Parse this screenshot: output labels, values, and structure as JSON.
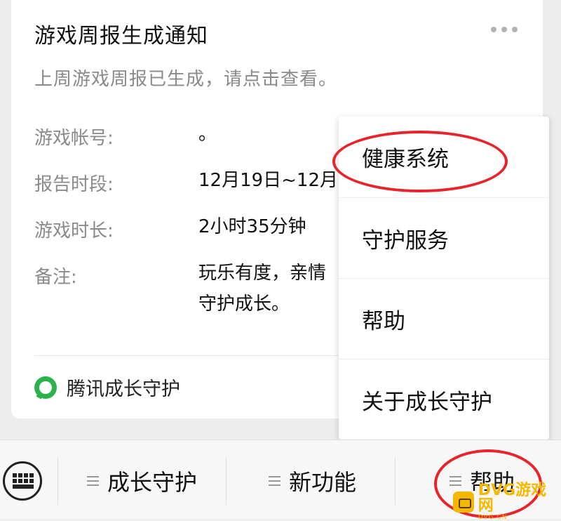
{
  "card": {
    "title": "游戏周报生成通知",
    "subtitle": "上周游戏周报已生成，请点击查看。",
    "rows": [
      {
        "label": "游戏帐号:",
        "value": "。"
      },
      {
        "label": "报告时段:",
        "value": "12月19日~12月"
      },
      {
        "label": "游戏时长:",
        "value": "2小时35分钟"
      },
      {
        "label": "备注:",
        "value": "玩乐有度，亲情",
        "value2": "守护成长。"
      }
    ],
    "brand": "腾讯成长守护"
  },
  "menu": {
    "items": [
      "健康系统",
      "守护服务",
      "帮助",
      "关于成长守护"
    ]
  },
  "bottombar": {
    "tabs": [
      "成长守护",
      "新功能",
      "帮助"
    ]
  },
  "watermark": {
    "text": "DVG游戏网",
    "sub": "DVG.CN"
  },
  "colors": {
    "highlight_ring": "#e8232a",
    "brand_green": "#2bb24c",
    "watermark": "#f5b800"
  },
  "icons": [
    "more-dots-icon",
    "brand-logo-icon",
    "keyboard-icon",
    "menu-lines-icon"
  ]
}
